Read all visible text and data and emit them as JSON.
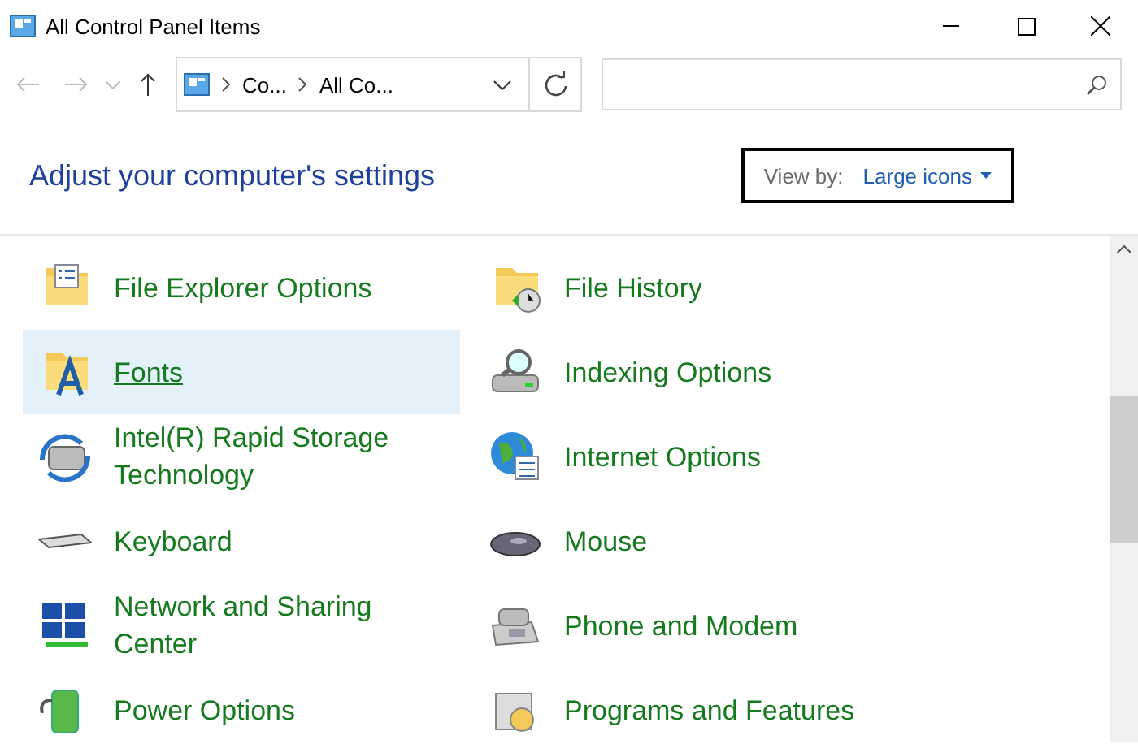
{
  "window": {
    "title": "All Control Panel Items"
  },
  "address_bar": {
    "breadcrumbs": [
      "Co...",
      "All Co..."
    ]
  },
  "header": {
    "title": "Adjust your computer's settings",
    "view_by_label": "View by:",
    "view_by_value": "Large icons"
  },
  "items": [
    {
      "label": "File Explorer Options",
      "selected": false
    },
    {
      "label": "File History",
      "selected": false
    },
    {
      "label": "Fonts",
      "selected": true
    },
    {
      "label": "Indexing Options",
      "selected": false
    },
    {
      "label": "Intel(R) Rapid Storage Technology",
      "selected": false
    },
    {
      "label": "Internet Options",
      "selected": false
    },
    {
      "label": "Keyboard",
      "selected": false
    },
    {
      "label": "Mouse",
      "selected": false
    },
    {
      "label": "Network and Sharing Center",
      "selected": false
    },
    {
      "label": "Phone and Modem",
      "selected": false
    },
    {
      "label": "Power Options",
      "selected": false
    },
    {
      "label": "Programs and Features",
      "selected": false
    }
  ]
}
